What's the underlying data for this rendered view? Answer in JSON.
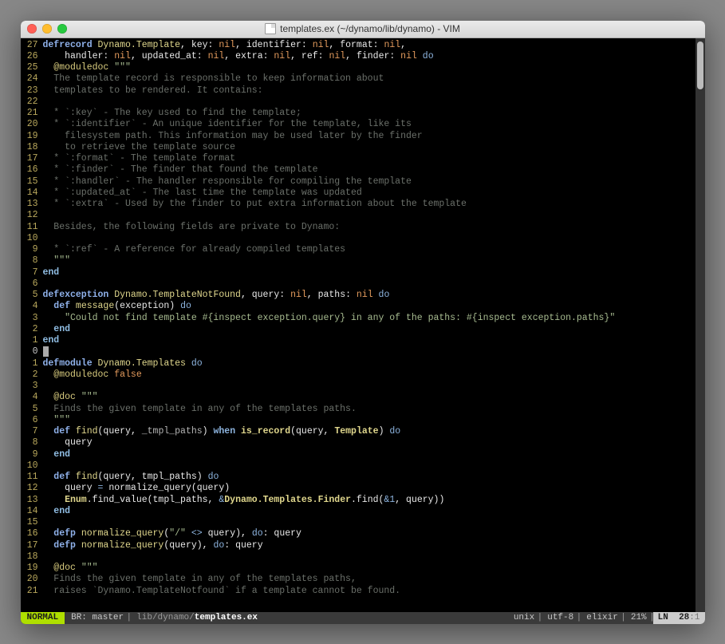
{
  "window": {
    "title": "templates.ex (~/dynamo/lib/dynamo) - VIM"
  },
  "gutter_numbers": [
    "27",
    "26",
    "25",
    "24",
    "23",
    "22",
    "21",
    "20",
    "19",
    "18",
    "17",
    "16",
    "15",
    "14",
    "13",
    "12",
    "11",
    "10",
    "9",
    "8",
    "7",
    "6",
    "5",
    "4",
    "3",
    "2",
    "1",
    "0",
    "1",
    "2",
    "3",
    "4",
    "5",
    "6",
    "7",
    "8",
    "9",
    "10",
    "11",
    "12",
    "13",
    "14",
    "15",
    "16",
    "17",
    "18",
    "19",
    "20",
    "21"
  ],
  "code_lines": [
    [
      {
        "c": "kw-def bold",
        "t": "defrecord "
      },
      {
        "c": "mod",
        "t": "Dynamo.Template"
      },
      {
        "c": "white",
        "t": ", key: "
      },
      {
        "c": "kw-nil",
        "t": "nil"
      },
      {
        "c": "white",
        "t": ", identifier: "
      },
      {
        "c": "kw-nil",
        "t": "nil"
      },
      {
        "c": "white",
        "t": ", format: "
      },
      {
        "c": "kw-nil",
        "t": "nil"
      },
      {
        "c": "white",
        "t": ","
      }
    ],
    [
      {
        "c": "white",
        "t": "    handler: "
      },
      {
        "c": "kw-nil",
        "t": "nil"
      },
      {
        "c": "white",
        "t": ", updated_at: "
      },
      {
        "c": "kw-nil",
        "t": "nil"
      },
      {
        "c": "white",
        "t": ", extra: "
      },
      {
        "c": "kw-nil",
        "t": "nil"
      },
      {
        "c": "white",
        "t": ", ref: "
      },
      {
        "c": "kw-nil",
        "t": "nil"
      },
      {
        "c": "white",
        "t": ", finder: "
      },
      {
        "c": "kw-nil",
        "t": "nil"
      },
      {
        "c": "kw-do",
        "t": " do"
      }
    ],
    [
      {
        "c": "sym",
        "t": "  @moduledoc "
      },
      {
        "c": "str",
        "t": "\"\"\""
      }
    ],
    [
      {
        "c": "cmt",
        "t": "  The template record is responsible to keep information about"
      }
    ],
    [
      {
        "c": "cmt",
        "t": "  templates to be rendered. It contains:"
      }
    ],
    [
      {
        "c": "",
        "t": ""
      }
    ],
    [
      {
        "c": "cmt",
        "t": "  * `:key` - The key used to find the template;"
      }
    ],
    [
      {
        "c": "cmt",
        "t": "  * `:identifier` - An unique identifier for the template, like its"
      }
    ],
    [
      {
        "c": "cmt",
        "t": "    filesystem path. This information may be used later by the finder"
      }
    ],
    [
      {
        "c": "cmt",
        "t": "    to retrieve the template source"
      }
    ],
    [
      {
        "c": "cmt",
        "t": "  * `:format` - The template format"
      }
    ],
    [
      {
        "c": "cmt",
        "t": "  * `:finder` - The finder that found the template"
      }
    ],
    [
      {
        "c": "cmt",
        "t": "  * `:handler` - The handler responsible for compiling the template"
      }
    ],
    [
      {
        "c": "cmt",
        "t": "  * `:updated_at` - The last time the template was updated"
      }
    ],
    [
      {
        "c": "cmt",
        "t": "  * `:extra` - Used by the finder to put extra information about the template"
      }
    ],
    [
      {
        "c": "",
        "t": ""
      }
    ],
    [
      {
        "c": "cmt",
        "t": "  Besides, the following fields are private to Dynamo:"
      }
    ],
    [
      {
        "c": "",
        "t": ""
      }
    ],
    [
      {
        "c": "cmt",
        "t": "  * `:ref` - A reference for already compiled templates"
      }
    ],
    [
      {
        "c": "str",
        "t": "  \"\"\""
      }
    ],
    [
      {
        "c": "kw-end bold",
        "t": "end"
      }
    ],
    [
      {
        "c": "",
        "t": ""
      }
    ],
    [
      {
        "c": "kw-def bold",
        "t": "defexception "
      },
      {
        "c": "mod",
        "t": "Dynamo.TemplateNotFound"
      },
      {
        "c": "white",
        "t": ", query: "
      },
      {
        "c": "kw-nil",
        "t": "nil"
      },
      {
        "c": "white",
        "t": ", paths: "
      },
      {
        "c": "kw-nil",
        "t": "nil"
      },
      {
        "c": "kw-do",
        "t": " do"
      }
    ],
    [
      {
        "c": "kw-def bold",
        "t": "  def "
      },
      {
        "c": "fn",
        "t": "message"
      },
      {
        "c": "white",
        "t": "(exception) "
      },
      {
        "c": "kw-do",
        "t": "do"
      }
    ],
    [
      {
        "c": "str",
        "t": "    \"Could not find template #{inspect exception.query} in any of the paths: #{inspect exception.paths}\""
      }
    ],
    [
      {
        "c": "kw-end bold",
        "t": "  end"
      }
    ],
    [
      {
        "c": "kw-end bold",
        "t": "end"
      }
    ],
    [
      {
        "c": "",
        "t": ""
      }
    ],
    [
      {
        "c": "kw-def bold",
        "t": "defmodule "
      },
      {
        "c": "mod",
        "t": "Dynamo.Templates"
      },
      {
        "c": "kw-do",
        "t": " do"
      }
    ],
    [
      {
        "c": "sym",
        "t": "  @moduledoc "
      },
      {
        "c": "kw-nil",
        "t": "false"
      }
    ],
    [
      {
        "c": "",
        "t": ""
      }
    ],
    [
      {
        "c": "sym",
        "t": "  @doc "
      },
      {
        "c": "str",
        "t": "\"\"\""
      }
    ],
    [
      {
        "c": "cmt",
        "t": "  Finds the given template in any of the templates paths."
      }
    ],
    [
      {
        "c": "str",
        "t": "  \"\"\""
      }
    ],
    [
      {
        "c": "kw-def bold",
        "t": "  def "
      },
      {
        "c": "fn",
        "t": "find"
      },
      {
        "c": "white",
        "t": "(query, "
      },
      {
        "c": "gray",
        "t": "_tmpl_paths"
      },
      {
        "c": "white",
        "t": ") "
      },
      {
        "c": "kw-do bold",
        "t": "when"
      },
      {
        "c": "white",
        "t": " "
      },
      {
        "c": "fn bold",
        "t": "is_record"
      },
      {
        "c": "white",
        "t": "(query, "
      },
      {
        "c": "mod bold",
        "t": "Template"
      },
      {
        "c": "white",
        "t": ") "
      },
      {
        "c": "kw-do",
        "t": "do"
      }
    ],
    [
      {
        "c": "white",
        "t": "    query"
      }
    ],
    [
      {
        "c": "kw-end bold",
        "t": "  end"
      }
    ],
    [
      {
        "c": "",
        "t": ""
      }
    ],
    [
      {
        "c": "kw-def bold",
        "t": "  def "
      },
      {
        "c": "fn",
        "t": "find"
      },
      {
        "c": "white",
        "t": "(query, tmpl_paths) "
      },
      {
        "c": "kw-do",
        "t": "do"
      }
    ],
    [
      {
        "c": "white",
        "t": "    query "
      },
      {
        "c": "kw-do",
        "t": "="
      },
      {
        "c": "white",
        "t": " normalize_query(query)"
      }
    ],
    [
      {
        "c": "mod bold",
        "t": "    Enum"
      },
      {
        "c": "white",
        "t": ".find_value(tmpl_paths, "
      },
      {
        "c": "kw-do",
        "t": "&"
      },
      {
        "c": "mod bold",
        "t": "Dynamo.Templates.Finder"
      },
      {
        "c": "white",
        "t": ".find("
      },
      {
        "c": "kw-do",
        "t": "&1"
      },
      {
        "c": "white",
        "t": ", query))"
      }
    ],
    [
      {
        "c": "kw-end bold",
        "t": "  end"
      }
    ],
    [
      {
        "c": "",
        "t": ""
      }
    ],
    [
      {
        "c": "kw-def bold",
        "t": "  defp "
      },
      {
        "c": "fn",
        "t": "normalize_query"
      },
      {
        "c": "white",
        "t": "("
      },
      {
        "c": "str",
        "t": "\"/\""
      },
      {
        "c": "white",
        "t": " "
      },
      {
        "c": "kw-do",
        "t": "<>"
      },
      {
        "c": "white",
        "t": " query), "
      },
      {
        "c": "kw-do",
        "t": "do"
      },
      {
        "c": "white",
        "t": ": query"
      }
    ],
    [
      {
        "c": "kw-def bold",
        "t": "  defp "
      },
      {
        "c": "fn",
        "t": "normalize_query"
      },
      {
        "c": "white",
        "t": "(query), "
      },
      {
        "c": "kw-do",
        "t": "do"
      },
      {
        "c": "white",
        "t": ": query"
      }
    ],
    [
      {
        "c": "",
        "t": ""
      }
    ],
    [
      {
        "c": "sym",
        "t": "  @doc "
      },
      {
        "c": "str",
        "t": "\"\"\""
      }
    ],
    [
      {
        "c": "cmt",
        "t": "  Finds the given template in any of the templates paths,"
      }
    ],
    [
      {
        "c": "cmt",
        "t": "  raises `Dynamo.TemplateNotfound` if a template cannot be found."
      }
    ]
  ],
  "cursor_line_index": 27,
  "statusline": {
    "mode": "NORMAL",
    "branch_label": "BR:",
    "branch": "master",
    "path_prefix": "lib/dynamo/",
    "filename": "templates.ex",
    "fileformat": "unix",
    "encoding": "utf-8",
    "filetype": "elixir",
    "percent": "21%",
    "ln_label": "LN",
    "line": "28",
    "col": "1"
  }
}
